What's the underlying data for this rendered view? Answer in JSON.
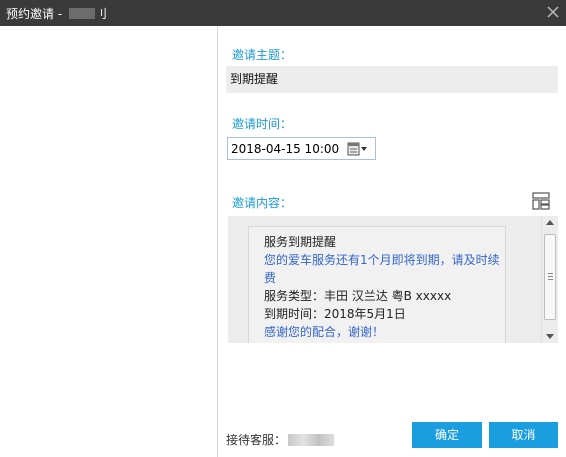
{
  "window": {
    "title": "预约邀请 - ",
    "title_suffix": "刂"
  },
  "form": {
    "subject_label": "邀请主题：",
    "subject_value": "到期提醒",
    "time_label": "邀请时间：",
    "time_value": "2018-04-15 10:00",
    "content_label": "邀请内容："
  },
  "message": {
    "heading": "服务到期提醒",
    "body": "您的爱车服务还有1个月即将到期，请及时续费",
    "service_type": "服务类型：丰田 汉兰达 粤B xxxxx",
    "expiry": "到期时间：2018年5月1日",
    "thanks": "感谢您的配合，谢谢！"
  },
  "footer": {
    "agent_label": "接待客服："
  },
  "buttons": {
    "confirm": "确定",
    "cancel": "取消"
  },
  "colors": {
    "titlebar": "#3a3a3a",
    "accent": "#1a9ee0",
    "label_blue": "#1a9bd7",
    "message_blue": "#3366cc"
  }
}
